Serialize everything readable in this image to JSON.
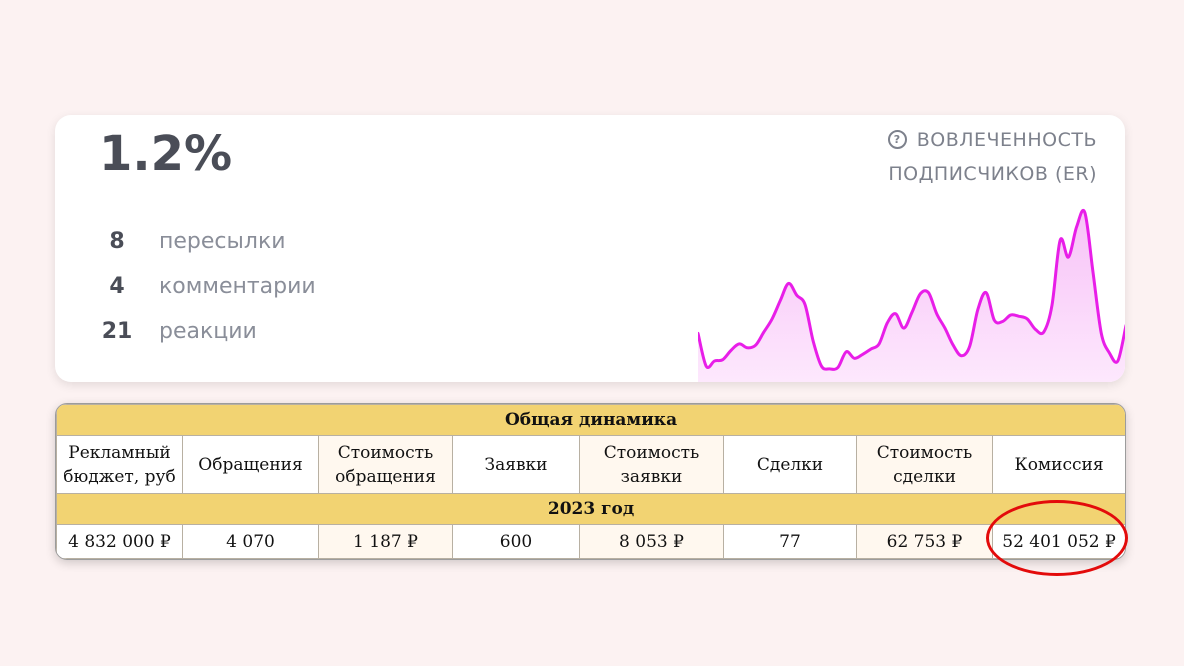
{
  "er_card": {
    "value": "1.2%",
    "title_line1": "ВОВЛЕЧЕННОСТЬ",
    "title_line2": "ПОДПИСЧИКОВ (ER)",
    "help_icon": "?",
    "metrics": [
      {
        "count": "8",
        "label": "пересылки"
      },
      {
        "count": "4",
        "label": "комментарии"
      },
      {
        "count": "21",
        "label": "реакции"
      }
    ],
    "line_color": "#e81ee8",
    "fill_color": "#f7c2f7"
  },
  "chart_data": {
    "type": "area",
    "title": "",
    "xlabel": "",
    "ylabel": "",
    "grid": false,
    "series": [
      {
        "values": [
          37,
          12,
          16,
          17,
          24,
          29,
          26,
          28,
          38,
          48,
          62,
          75,
          66,
          59,
          31,
          12,
          10,
          11,
          23,
          18,
          21,
          25,
          29,
          45,
          52,
          41,
          53,
          67,
          68,
          52,
          41,
          28,
          20,
          27,
          55,
          68,
          47,
          46,
          51,
          50,
          48,
          40,
          38,
          58,
          108,
          95,
          118,
          129,
          83,
          37,
          22,
          16,
          43
        ]
      }
    ],
    "ylim": [
      0,
      140
    ]
  },
  "table": {
    "title": "Общая динамика",
    "headers": [
      [
        "Рекламный",
        "бюджет, руб"
      ],
      [
        "Обращения"
      ],
      [
        "Стоимость",
        "обращения"
      ],
      [
        "Заявки"
      ],
      [
        "Стоимость",
        "заявки"
      ],
      [
        "Сделки"
      ],
      [
        "Стоимость",
        "сделки"
      ],
      [
        "Комиссия"
      ]
    ],
    "year_label": "2023 год",
    "values": [
      "4 832 000 ₽",
      "4 070",
      "1 187 ₽",
      "600",
      "8 053 ₽",
      "77",
      "62 753 ₽",
      "52 401 052 ₽"
    ],
    "header_color": "#f2d372",
    "highlight_color": "#e30b0b"
  }
}
